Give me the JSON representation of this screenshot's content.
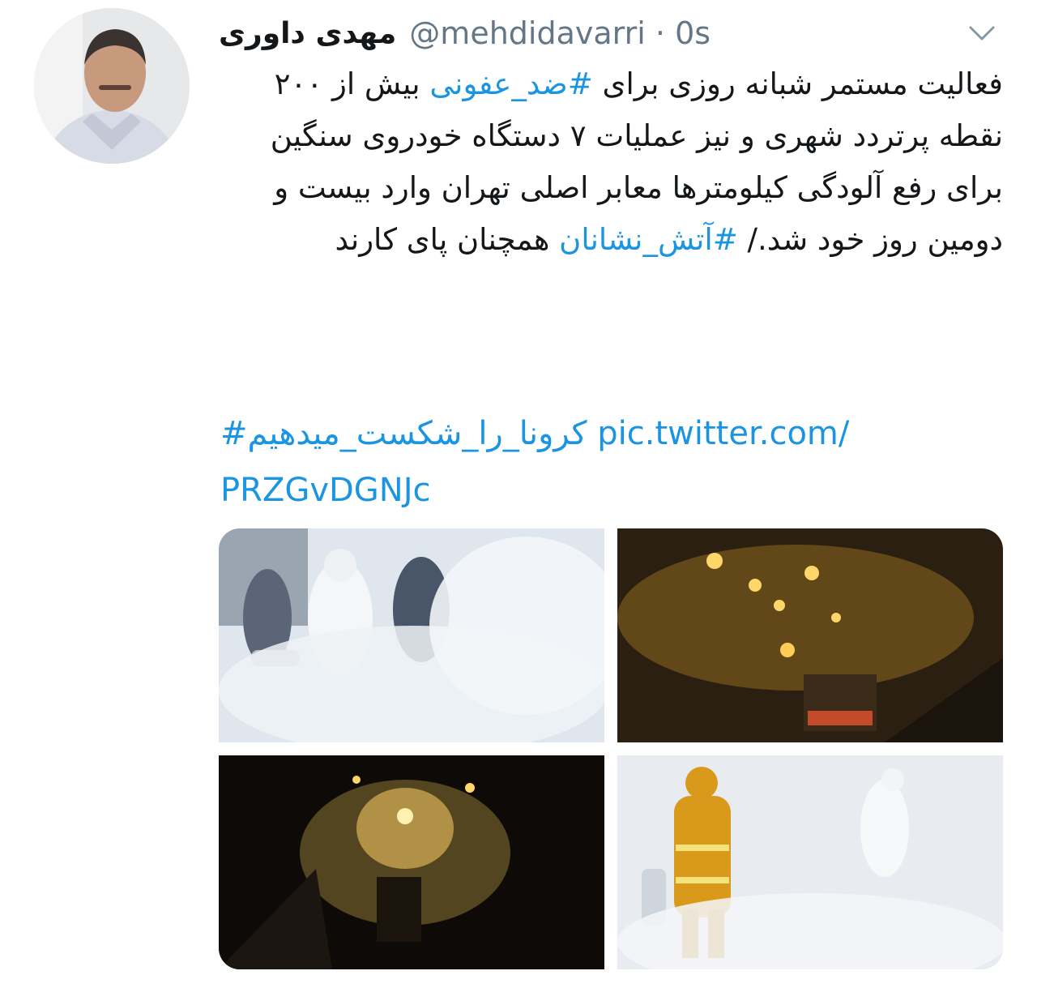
{
  "tweet": {
    "author_name": "مهدی داوری",
    "handle": "@mehdidavarri",
    "separator": "·",
    "time": "0s",
    "text_part1": "فعالیت مستمر شبانه روزی برای ",
    "hashtag1": "#ضد_عفونی",
    "text_part2": " بیش از ۲۰۰ نقطه پرتردد شهری و نیز عملیات ۷ دستگاه خودروی سنگین برای رفع آلودگی کیلومترها معابر اصلی تهران وارد بیست و دومین روز خود شد./ ",
    "hashtag2": "#آتش_نشانان",
    "text_part3": " همچنان پای کارند",
    "hashtag3": "#کرونا_را_شکست_میدهیم",
    "link_part1": "pic.twitter.com/",
    "link_part2": "PRZGvDGNJc"
  },
  "icons": {
    "menu": "chevron-down-icon"
  },
  "colors": {
    "link": "#1b95e0",
    "text": "#14171a",
    "meta": "#657786"
  }
}
